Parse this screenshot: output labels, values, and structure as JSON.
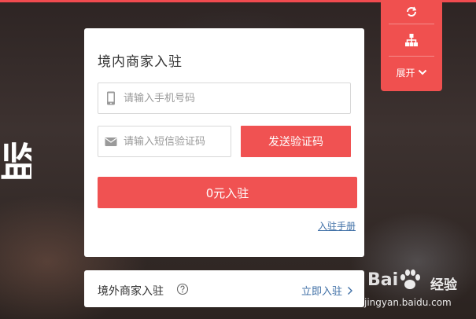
{
  "background": {
    "glyph": "监"
  },
  "tool_panel": {
    "refresh_icon": "refresh-icon",
    "sitemap_icon": "sitemap-icon",
    "expand_label": "展开",
    "expand_icon": "chevron-down-icon"
  },
  "domestic": {
    "title": "境内商家入驻",
    "phone_placeholder": "请输入手机号码",
    "phone_icon": "phone-icon",
    "sms_placeholder": "请输入短信验证码",
    "sms_icon": "message-icon",
    "send_code_label": "发送验证码",
    "submit_label": "0元入驻",
    "manual_link": "入驻手册"
  },
  "overseas": {
    "title": "境外商家入驻",
    "help_icon": "question-circle-icon",
    "enter_link": "立即入驻",
    "enter_icon": "chevron-right-icon"
  },
  "watermark": {
    "brand": "Bai",
    "logo_icon": "paw-icon",
    "jingyan": "经验",
    "url": "jingyan.baidu.com"
  },
  "colors": {
    "accent": "#f05252",
    "link": "#3f6fa6",
    "top_bar": "#f04b4f"
  }
}
